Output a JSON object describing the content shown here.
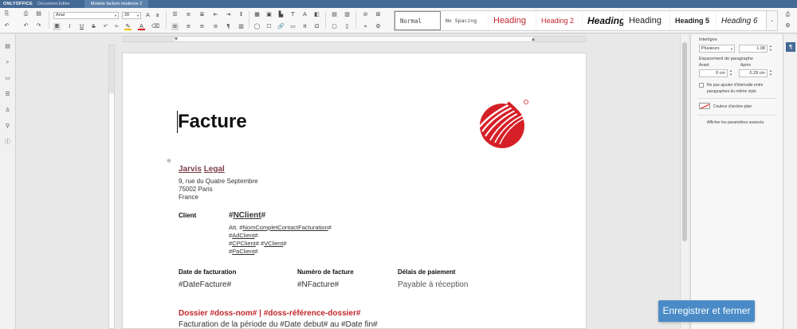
{
  "titlebar": {
    "brand": "ONLYOFFICE",
    "app": "Document Editor",
    "doc_title": "Modele facture moderne 2"
  },
  "toolbar": {
    "font_name": "Arial",
    "font_size": "28"
  },
  "styles": [
    {
      "label": "Normal",
      "color": "#333333"
    },
    {
      "label": "No Spacing",
      "color": "#333333"
    },
    {
      "label": "Heading",
      "color": "#c0272d"
    },
    {
      "label": "Heading 2",
      "color": "#c0272d"
    },
    {
      "label": "Heading",
      "color": "#111111"
    },
    {
      "label": "Heading",
      "color": "#222222"
    },
    {
      "label": "Heading 5",
      "color": "#222222"
    },
    {
      "label": "Heading 6",
      "color": "#222222"
    }
  ],
  "document": {
    "title": "Facture",
    "company": {
      "name_part1": "Jarvis",
      "name_part2": "Legal",
      "address": [
        "9, rue du Quatre Septembre",
        "75002 Paris",
        "France"
      ]
    },
    "client": {
      "label": "Client",
      "hash1": "#",
      "field": "NClient",
      "hash2": "#",
      "line1_prefix": "Att. #",
      "line1_field": "NomCompletContactFacturation",
      "line1_suffix": "#",
      "line2_prefix": "#",
      "line2_field": "AdClient",
      "line2_suffix": "#",
      "line3_prefix": "#",
      "line3_field": "CPClient",
      "line3_mid": "# #",
      "line3_field2": "VClient",
      "line3_suffix": "#",
      "line4_prefix": "#",
      "line4_field": "PaClient",
      "line4_suffix": "#"
    },
    "invoice": {
      "date_label": "Date de facturation",
      "date_value": "#DateFacture#",
      "num_label": "Numéro de facture",
      "num_value": "#NFacture#",
      "terms_label": "Délais de paiement",
      "terms_value": "Payable à réception"
    },
    "dossier": {
      "title": "Dossier #doss-nom# | #doss-référence-dossier#",
      "period": "Facturation de la période du #Date debut# au #Date fin#"
    }
  },
  "right_panel": {
    "line_spacing_label": "Interligne",
    "line_spacing_mode": "Plusieurs",
    "line_spacing_value": "1.08",
    "para_spacing_label": "Espacement de paragraphe",
    "before_label": "Avant",
    "after_label": "Après",
    "before_value": "0 cm",
    "after_value": "0.28 cm",
    "no_interval_label": "Ne pas ajouter d'intervalle entre paragraphes du même style",
    "bg_color_label": "Couleur d'arrière-plan",
    "advanced_link": "Afficher les paramètres avancés"
  },
  "save_button": "Enregistrer et fermer",
  "colors": {
    "accent": "#446995",
    "brand_red": "#c0272d",
    "save": "#4a8bc7"
  }
}
